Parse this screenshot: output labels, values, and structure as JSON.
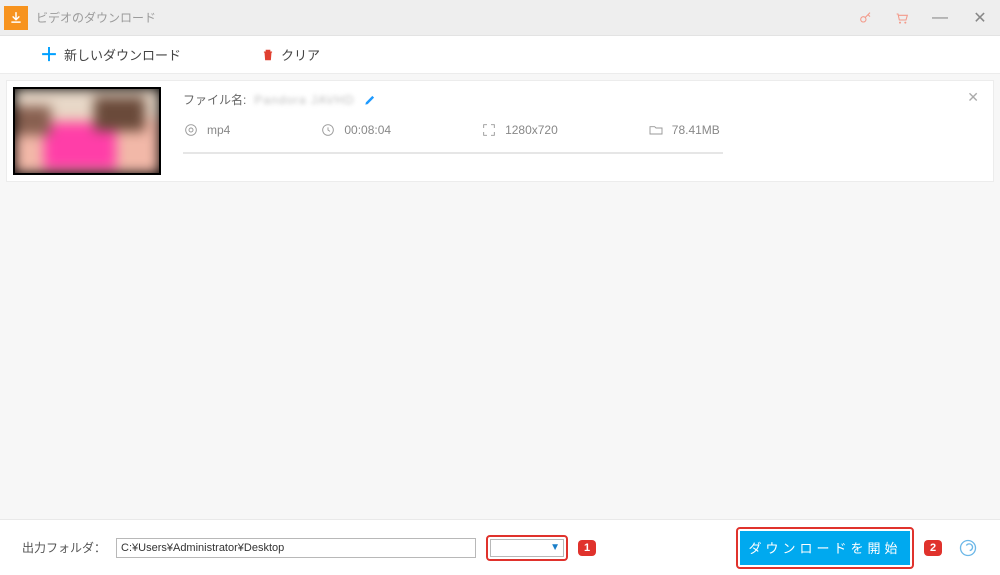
{
  "titlebar": {
    "title": "ビデオのダウンロード"
  },
  "toolbar": {
    "new_download": "新しいダウンロード",
    "clear": "クリア"
  },
  "item": {
    "filename_label": "ファイル名:",
    "filename_value": "Pandora JAVHD",
    "format": "mp4",
    "duration": "00:08:04",
    "resolution": "1280x720",
    "size": "78.41MB"
  },
  "bottom": {
    "output_label": "出力フォルダ：",
    "output_path": "C:¥Users¥Administrator¥Desktop",
    "step1": "1",
    "step2": "2",
    "start_download": "ダウンロードを開始"
  }
}
